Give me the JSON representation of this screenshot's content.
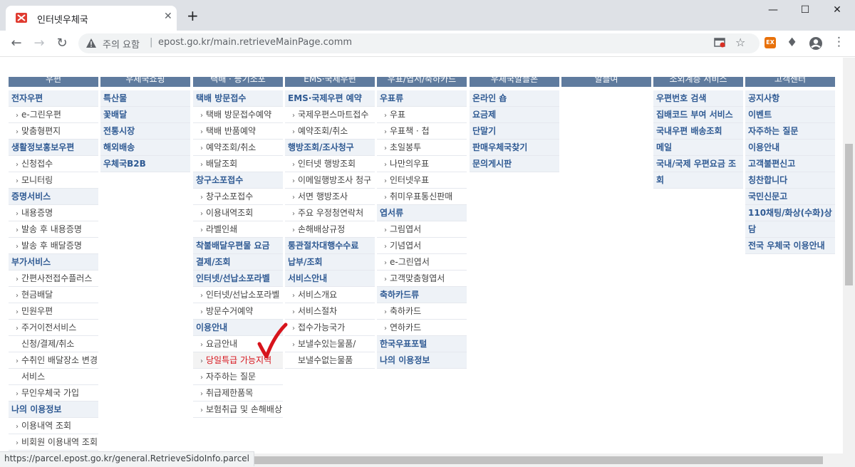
{
  "browser": {
    "tab_title": "인터넷우체국",
    "tab_close": "✕",
    "new_tab": "+",
    "window_minimize": "—",
    "window_maximize": "☐",
    "window_close": "✕",
    "security_label": "주의 요함",
    "separator": "|",
    "url": "epost.go.kr/main.retrieveMainPage.comm",
    "status_url": "https://parcel.epost.go.kr/general.RetrieveSidoInfo.parcel",
    "ext_badge": "EX",
    "accent_color": "#5f7b9e"
  },
  "columns": [
    {
      "header": "우편",
      "items": [
        {
          "text": "전자우편",
          "level": 1
        },
        {
          "text": "e-그린우편",
          "level": 2
        },
        {
          "text": "맞춤형편지",
          "level": 2
        },
        {
          "text": "생활정보홍보우편",
          "level": 1
        },
        {
          "text": "신청접수",
          "level": 2
        },
        {
          "text": "모니터링",
          "level": 2
        },
        {
          "text": "증명서비스",
          "level": 1
        },
        {
          "text": "내용증명",
          "level": 2
        },
        {
          "text": "발송 후 내용증명",
          "level": 2
        },
        {
          "text": "발송 후 배달증명",
          "level": 2
        },
        {
          "text": "부가서비스",
          "level": 1
        },
        {
          "text": "간편사전접수플러스",
          "level": 2
        },
        {
          "text": "현금배달",
          "level": 2
        },
        {
          "text": "민원우편",
          "level": 2
        },
        {
          "text": "주거이전서비스",
          "level": 2
        },
        {
          "text": "신청/결제/취소",
          "level": 3
        },
        {
          "text": "수취인 배달장소 변경",
          "level": 2
        },
        {
          "text": "서비스",
          "level": 3
        },
        {
          "text": "무인우체국 가입",
          "level": 2
        },
        {
          "text": "나의 이용정보",
          "level": 1
        },
        {
          "text": "이용내역 조회",
          "level": 2
        },
        {
          "text": "비회원 이용내역 조회",
          "level": 2
        }
      ]
    },
    {
      "header": "우체국쇼핑",
      "items": [
        {
          "text": "특산물",
          "level": 1
        },
        {
          "text": "꽃배달",
          "level": 1
        },
        {
          "text": "전통시장",
          "level": 1
        },
        {
          "text": "해외배송",
          "level": 1
        },
        {
          "text": "우체국B2B",
          "level": 1
        }
      ]
    },
    {
      "header": "택배 · 등기소포",
      "items": [
        {
          "text": "택배 방문접수",
          "level": 1
        },
        {
          "text": "택배 방문접수예약",
          "level": 2
        },
        {
          "text": "택배 반품예약",
          "level": 2
        },
        {
          "text": "예약조회/취소",
          "level": 2
        },
        {
          "text": "배달조회",
          "level": 2
        },
        {
          "text": "창구소포접수",
          "level": 1
        },
        {
          "text": "창구소포접수",
          "level": 2
        },
        {
          "text": "이용내역조회",
          "level": 2
        },
        {
          "text": "라벨인쇄",
          "level": 2
        },
        {
          "text": "착불배달우편물 요금",
          "level": 1
        },
        {
          "text": "결제/조회",
          "level": 1
        },
        {
          "text": "인터넷/선납소포라벨",
          "level": 1
        },
        {
          "text": "인터넷/선납소포라벨",
          "level": 2
        },
        {
          "text": "방문수거예약",
          "level": 2
        },
        {
          "text": "이용안내",
          "level": 1
        },
        {
          "text": "요금안내",
          "level": 2
        },
        {
          "text": "당일특급 가능지역",
          "level": 2,
          "hot": true
        },
        {
          "text": "자주하는 질문",
          "level": 2
        },
        {
          "text": "취급제한품목",
          "level": 2
        },
        {
          "text": "보험취급 및 손해배상",
          "level": 2
        }
      ]
    },
    {
      "header": "EMS·국제우편",
      "items": [
        {
          "text": "EMS·국제우편 예약",
          "level": 1
        },
        {
          "text": "국제우편스마트접수",
          "level": 2
        },
        {
          "text": "예약조회/취소",
          "level": 2
        },
        {
          "text": "행방조회/조사청구",
          "level": 1
        },
        {
          "text": "인터넷 행방조회",
          "level": 2
        },
        {
          "text": "이메일행방조사 청구",
          "level": 2
        },
        {
          "text": "서면 행방조사",
          "level": 2
        },
        {
          "text": "주요 우정청연락처",
          "level": 2
        },
        {
          "text": "손해배상규정",
          "level": 2
        },
        {
          "text": "통관절차대행수수료",
          "level": 1
        },
        {
          "text": "납부/조회",
          "level": 1
        },
        {
          "text": "서비스안내",
          "level": 1
        },
        {
          "text": "서비스개요",
          "level": 2
        },
        {
          "text": "서비스절차",
          "level": 2
        },
        {
          "text": "접수가능국가",
          "level": 2
        },
        {
          "text": "보낼수있는물품/",
          "level": 2
        },
        {
          "text": "보낼수없는물품",
          "level": 3
        }
      ]
    },
    {
      "header": "우표/엽서/축하카드",
      "items": [
        {
          "text": "우표류",
          "level": 1
        },
        {
          "text": "우표",
          "level": 2
        },
        {
          "text": "우표책 · 첩",
          "level": 2
        },
        {
          "text": "초일봉투",
          "level": 2
        },
        {
          "text": "나만의우표",
          "level": 2
        },
        {
          "text": "인터넷우표",
          "level": 2
        },
        {
          "text": "취미우표통신판매",
          "level": 2
        },
        {
          "text": "엽서류",
          "level": 1
        },
        {
          "text": "그림엽서",
          "level": 2
        },
        {
          "text": "기념엽서",
          "level": 2
        },
        {
          "text": "e-그린엽서",
          "level": 2
        },
        {
          "text": "고객맞춤형엽서",
          "level": 2
        },
        {
          "text": "축하카드류",
          "level": 1
        },
        {
          "text": "축하카드",
          "level": 2
        },
        {
          "text": "연하카드",
          "level": 2
        },
        {
          "text": "한국우표포털",
          "level": 1
        },
        {
          "text": "나의 이용정보",
          "level": 1
        }
      ]
    },
    {
      "header": "우체국알뜰폰",
      "items": [
        {
          "text": "온라인 숍",
          "level": 1
        },
        {
          "text": "요금제",
          "level": 1
        },
        {
          "text": "단말기",
          "level": 1
        },
        {
          "text": "판매우체국찾기",
          "level": 1
        },
        {
          "text": "문의게시판",
          "level": 1
        }
      ]
    },
    {
      "header": "알뜰여",
      "items": []
    },
    {
      "header": "소외계층 서비스",
      "items": [
        {
          "text": "우편번호 검색",
          "level": 1
        },
        {
          "text": "집배코드 부여 서비스",
          "level": 1
        },
        {
          "text": "국내우편 배송조회",
          "level": 1
        },
        {
          "text": "메일",
          "level": 1
        },
        {
          "text": "국내/국제 우편요금 조",
          "level": 1
        },
        {
          "text": "회",
          "level": 1,
          "cont": true
        }
      ]
    },
    {
      "header": "고객센터",
      "items": [
        {
          "text": "공지사항",
          "level": 1
        },
        {
          "text": "이벤트",
          "level": 1
        },
        {
          "text": "자주하는 질문",
          "level": 1
        },
        {
          "text": "이용안내",
          "level": 1
        },
        {
          "text": "고객불편신고",
          "level": 1
        },
        {
          "text": "칭찬합니다",
          "level": 1
        },
        {
          "text": "국민신문고",
          "level": 1
        },
        {
          "text": "110채팅/화상(수화)상",
          "level": 1
        },
        {
          "text": "담",
          "level": 1,
          "cont": true
        },
        {
          "text": "전국 우체국 이용안내",
          "level": 1
        }
      ]
    }
  ]
}
